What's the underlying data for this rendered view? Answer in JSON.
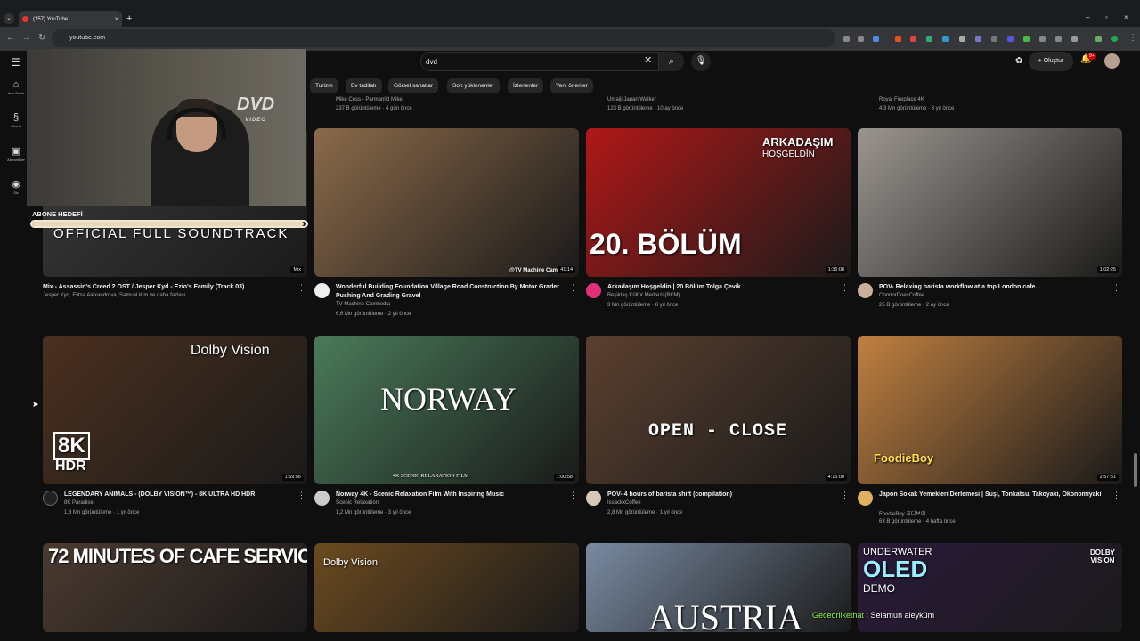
{
  "browser": {
    "tab_title": "(157) YouTube",
    "url": "youtube.com"
  },
  "header": {
    "search_value": "dvd",
    "create_label": "Oluştur",
    "notif_count": "9+"
  },
  "rail": [
    "Ana Sayfa",
    "Shorts",
    "Abonelikler",
    "Siz"
  ],
  "chips": [
    "Turizm",
    "Ev tadilatı",
    "Görsel sanatlar",
    "Son yüklenenler",
    "İzlenenler",
    "Yeni öneriler"
  ],
  "partial_meta": [
    {
      "line1": "Mike Cess - Parmanlid Mike",
      "line2": "237 B görüntüleme · 4 gün önce"
    },
    {
      "line1": "Umaiji Japan Walker",
      "line2": "123 B görüntüleme · 10 ay önce"
    },
    {
      "line1": "Royal Fireplace 4K",
      "line2": "4,3 Mn görüntüleme · 3 yıl önce"
    }
  ],
  "videos": [
    {
      "title": "Mix - Assassin's Creed 2 OST / Jesper Kyd - Ezio's Family (Track 03)",
      "channel": "Jesper Kyd, Elitsa Alexandrova, Samuel Kim ve daha fazlası",
      "stats": "",
      "duration": "Mix",
      "thumb_text": "OFFICIAL FULL SOUNDTRACK",
      "bg": "#3a3a3a"
    },
    {
      "title": "Wonderful Building Foundation Village Road Construction By Motor Grader Pushing And Grading Gravel",
      "channel": "TV Machine Cambodia",
      "stats": "6,6 Mn görüntüleme · 2 yıl önce",
      "duration": "41:14",
      "thumb_text": "@TV Machine Cam",
      "bg": "#8a6a4a"
    },
    {
      "title": "Arkadaşım Hoşgeldin | 20.Bölüm  Tolga Çevik",
      "channel": "Beşiktaş Kültür Merkezi (BKM)",
      "stats": "3 Mn görüntüleme · 8 yıl önce",
      "duration": "1:36:08",
      "thumb_text": "20. BÖLÜM",
      "thumb_text2": "ARKADAŞIM",
      "thumb_text3": "HOŞGELDİN",
      "bg": "#b01818"
    },
    {
      "title": "POV- Relaxing barista workflow at a top London cafe...",
      "channel": "ConnorDoesCoffee",
      "stats": "25 B görüntüleme · 2 ay önce",
      "duration": "1:02:25",
      "thumb_text": "",
      "bg": "#9a9590"
    },
    {
      "title": "LEGENDARY ANIMALS - (DOLBY VISION™) - 8K ULTRA HD HDR",
      "channel": "8K Paradise",
      "stats": "1,8 Mn görüntüleme · 1 yıl önce",
      "duration": "1:59:56",
      "thumb_text": "Dolby Vision",
      "thumb_text2": "8K",
      "thumb_text3": "HDR",
      "bg": "#4a3020"
    },
    {
      "title": "Norway 4K - Scenic Relaxation Film With Inspiring Music",
      "channel": "Scenic Relaxation",
      "stats": "1,2 Mn görüntüleme · 3 yıl önce",
      "duration": "1:00:58",
      "thumb_text": "NORWAY",
      "thumb_text2": "4K SCENIC RELAXATION FILM",
      "bg": "#4a7a5a"
    },
    {
      "title": "POV- 4 hours of barista shift (compilation)",
      "channel": "IssackxCoffee",
      "stats": "2,8 Mn görüntüleme · 1 yıl önce",
      "duration": "4:15:00",
      "thumb_text": "OPEN - CLOSE",
      "bg": "#5a4030"
    },
    {
      "title": "Japon Sokak Yemekleri Derlemesi | Suşi, Tonkatsu, Takoyaki, Okonomiyaki",
      "channel": "FoodieBoy 푸디보이",
      "stats": "63 B görüntüleme · 4 hafta önce",
      "duration": "2:57:51",
      "thumb_text": "FoodieBoy",
      "bg": "#c08040"
    },
    {
      "title": "",
      "channel": "",
      "stats": "",
      "duration": "",
      "thumb_text": "72 MINUTES OF CAFE SERVICE",
      "bg": "#4a3a30"
    },
    {
      "title": "",
      "channel": "",
      "stats": "",
      "duration": "",
      "thumb_text": "Dolby Vision",
      "bg": "#6a4a20"
    },
    {
      "title": "",
      "channel": "",
      "stats": "",
      "duration": "",
      "thumb_text": "AUSTRIA",
      "bg": "#7a8aa0"
    },
    {
      "title": "",
      "channel": "",
      "stats": "",
      "duration": "",
      "thumb_text": "UNDERWATER",
      "thumb_text2": "OLED",
      "thumb_text3": "DEMO",
      "thumb_text4": "DOLBY VISION",
      "bg": "#2a1a3a"
    }
  ],
  "overlay": {
    "goal_label": "ABONE HEDEFİ",
    "goal_progress": 0.99,
    "dvd_logo": "DVD",
    "dvd_sub": "VIDEO",
    "chat_user": "Geceorlikethat",
    "chat_msg": ": Selamun aleyküm"
  }
}
